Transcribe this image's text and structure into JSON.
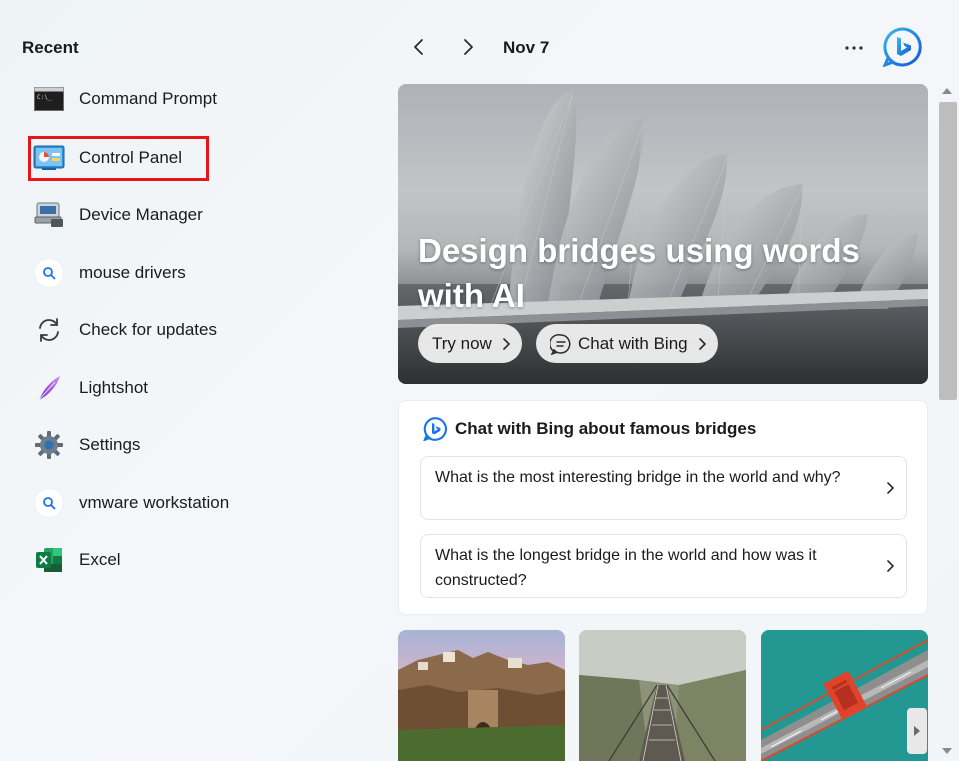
{
  "recent": {
    "title": "Recent",
    "items": [
      {
        "label": "Command Prompt",
        "icon": "command-prompt-icon"
      },
      {
        "label": "Control Panel",
        "icon": "control-panel-icon"
      },
      {
        "label": "Device Manager",
        "icon": "device-manager-icon"
      },
      {
        "label": "mouse drivers",
        "icon": "search-icon"
      },
      {
        "label": "Check for updates",
        "icon": "refresh-icon"
      },
      {
        "label": "Lightshot",
        "icon": "lightshot-feather-icon"
      },
      {
        "label": "Settings",
        "icon": "gear-icon"
      },
      {
        "label": "vmware workstation",
        "icon": "search-icon"
      },
      {
        "label": "Excel",
        "icon": "excel-icon"
      }
    ],
    "highlighted_index": 1,
    "highlight_color": "#e8141a"
  },
  "header": {
    "date": "Nov 7",
    "more_label": "···"
  },
  "hero": {
    "title": "Design bridges using words with AI",
    "try_now_label": "Try now",
    "chat_label": "Chat with Bing"
  },
  "chat_card": {
    "title": "Chat with Bing about famous bridges",
    "questions": [
      "What is the most interesting bridge in the world and why?",
      "What is the longest bridge in the world and how was it constructed?"
    ]
  },
  "colors": {
    "bing_blue": "#1a73e8",
    "excel_green": "#1d6f42",
    "accent_red": "#e8141a"
  }
}
